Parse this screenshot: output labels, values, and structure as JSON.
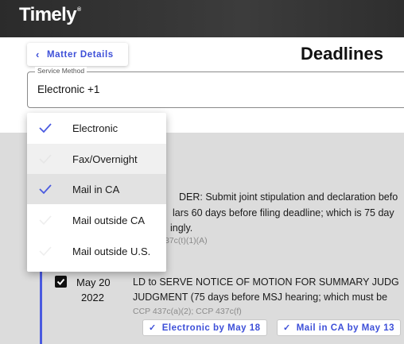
{
  "app": {
    "logo": "Timely",
    "logo_mark": "®"
  },
  "header": {
    "back_label": "Matter Details",
    "page_title": "Deadlines"
  },
  "service_method": {
    "label": "Service Method",
    "value": "Electronic +1",
    "options": [
      {
        "label": "Electronic",
        "checked": true
      },
      {
        "label": "Fax/Overnight",
        "checked": false
      },
      {
        "label": "Mail in CA",
        "checked": true
      },
      {
        "label": "Mail outside CA",
        "checked": false
      },
      {
        "label": "Mail outside U.S.",
        "checked": false
      }
    ]
  },
  "background_deadline": {
    "line1": "DER: Submit joint stipulation and declaration befo",
    "line2": "lars 60 days before filing deadline; which is 75 day",
    "line3": "ingly.",
    "citation": "37c(t)(1)(A)"
  },
  "deadline": {
    "date": "May 20",
    "year": "2022",
    "line1": "LD to SERVE NOTICE OF MOTION FOR SUMMARY JUDG",
    "line2": "JUDGMENT (75 days before MSJ hearing; which must be",
    "citation": "CCP 437c(a)(2); CCP 437c(f)",
    "chips": [
      {
        "label": "Electronic by May 18"
      },
      {
        "label": "Mail in CA by May 13"
      }
    ]
  },
  "colors": {
    "accent": "#3d4fd8",
    "check": "#4a5ae0"
  }
}
